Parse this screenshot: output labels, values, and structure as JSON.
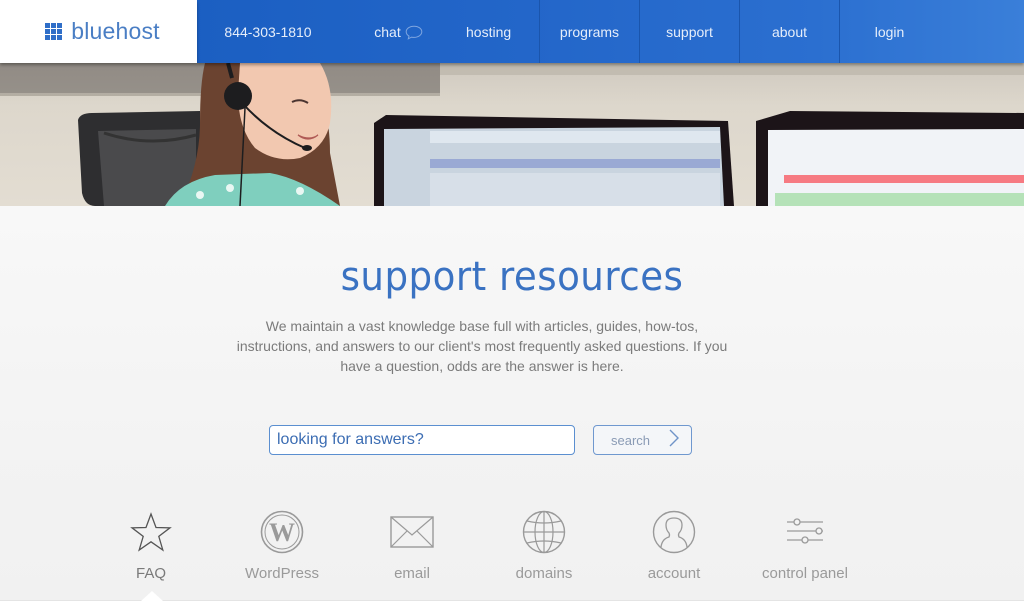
{
  "header": {
    "logo_text": "bluehost",
    "nav": {
      "phone": "844-303-1810",
      "chat": "chat",
      "hosting": "hosting",
      "programs": "programs",
      "support": "support",
      "about": "about",
      "login": "login"
    }
  },
  "hero": {
    "image_description": "smiling support agent wearing a headset in front of computer monitors"
  },
  "main": {
    "title": "support resources",
    "description": "We maintain a vast knowledge base full with articles, guides, how-tos, instructions, and answers to our client's most frequently asked questions. If you have a question, odds are the answer is here.",
    "search": {
      "placeholder": "looking for answers?",
      "value": "",
      "button_label": "search"
    },
    "categories": [
      {
        "label": "FAQ",
        "icon": "star-icon",
        "active": true
      },
      {
        "label": "WordPress",
        "icon": "wordpress-icon",
        "active": false
      },
      {
        "label": "email",
        "icon": "envelope-icon",
        "active": false
      },
      {
        "label": "domains",
        "icon": "globe-icon",
        "active": false
      },
      {
        "label": "account",
        "icon": "user-icon",
        "active": false
      },
      {
        "label": "control panel",
        "icon": "sliders-icon",
        "active": false
      }
    ]
  },
  "colors": {
    "brand_blue": "#2366c9",
    "title_blue": "#3a72c2",
    "icon_gray": "#9a9a9a"
  }
}
